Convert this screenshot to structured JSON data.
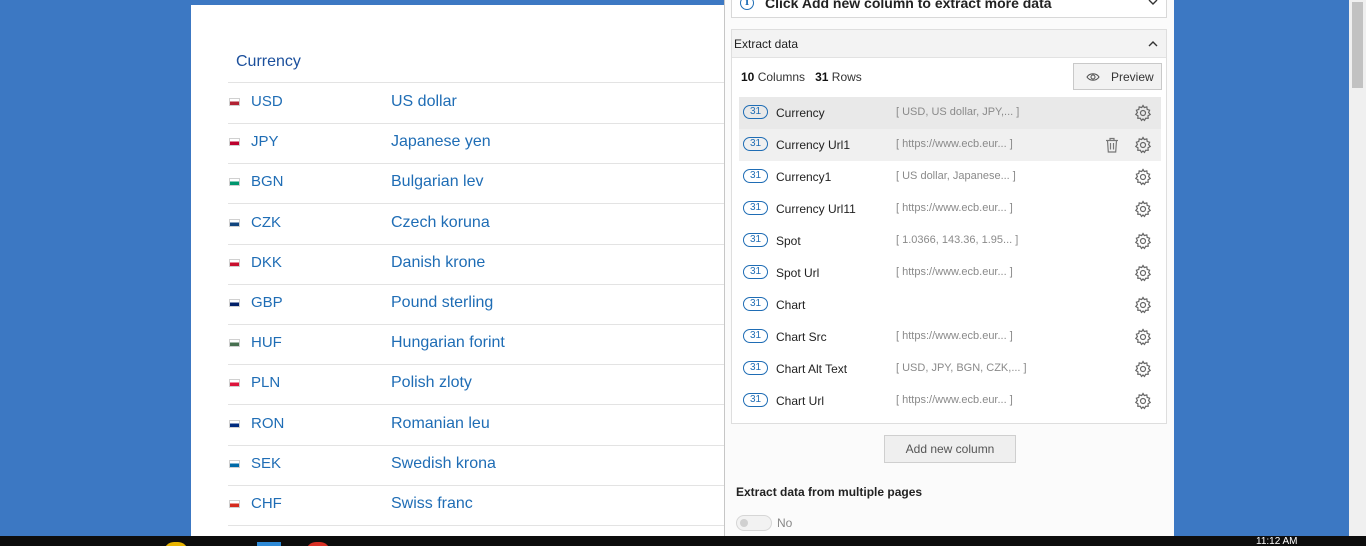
{
  "webpage": {
    "column_header": "Currency",
    "currencies": [
      {
        "code": "USD",
        "name": "US dollar",
        "flag_color": "#b22234"
      },
      {
        "code": "JPY",
        "name": "Japanese yen",
        "flag_color": "#bc002d"
      },
      {
        "code": "BGN",
        "name": "Bulgarian lev",
        "flag_color": "#00966e"
      },
      {
        "code": "CZK",
        "name": "Czech koruna",
        "flag_color": "#11457e"
      },
      {
        "code": "DKK",
        "name": "Danish krone",
        "flag_color": "#c8102e"
      },
      {
        "code": "GBP",
        "name": "Pound sterling",
        "flag_color": "#012169"
      },
      {
        "code": "HUF",
        "name": "Hungarian forint",
        "flag_color": "#477050"
      },
      {
        "code": "PLN",
        "name": "Polish zloty",
        "flag_color": "#dc143c"
      },
      {
        "code": "RON",
        "name": "Romanian leu",
        "flag_color": "#002b7f"
      },
      {
        "code": "SEK",
        "name": "Swedish krona",
        "flag_color": "#006aa7"
      },
      {
        "code": "CHF",
        "name": "Swiss franc",
        "flag_color": "#d52b1e"
      }
    ]
  },
  "panel": {
    "hint_text": "Click Add new column to extract more data",
    "section_title": "Extract data",
    "columns_count": "10",
    "columns_label": "Columns",
    "rows_count": "31",
    "rows_label": "Rows",
    "preview_label": "Preview",
    "fields": [
      {
        "count": "31",
        "name": "Currency",
        "sample": "[ USD, US dollar, JPY,... ]"
      },
      {
        "count": "31",
        "name": "Currency Url1",
        "sample": "[ https://www.ecb.eur... ]"
      },
      {
        "count": "31",
        "name": "Currency1",
        "sample": "[ US dollar, Japanese... ]"
      },
      {
        "count": "31",
        "name": "Currency Url11",
        "sample": "[ https://www.ecb.eur... ]"
      },
      {
        "count": "31",
        "name": "Spot",
        "sample": "[ 1.0366, 143.36, 1.95... ]"
      },
      {
        "count": "31",
        "name": "Spot Url",
        "sample": "[ https://www.ecb.eur... ]"
      },
      {
        "count": "31",
        "name": "Chart",
        "sample": ""
      },
      {
        "count": "31",
        "name": "Chart Src",
        "sample": "[ https://www.ecb.eur... ]"
      },
      {
        "count": "31",
        "name": "Chart Alt Text",
        "sample": "[ USD, JPY, BGN, CZK,... ]"
      },
      {
        "count": "31",
        "name": "Chart Url",
        "sample": "[ https://www.ecb.eur... ]"
      }
    ],
    "add_column_label": "Add new column",
    "multi_page_label": "Extract data from multiple pages",
    "toggle_label": "No"
  },
  "taskbar": {
    "clock": "11:12 AM"
  },
  "colors": {
    "background": "#3c78c3",
    "link": "#1f6db5",
    "heading": "#1b4f9c"
  }
}
